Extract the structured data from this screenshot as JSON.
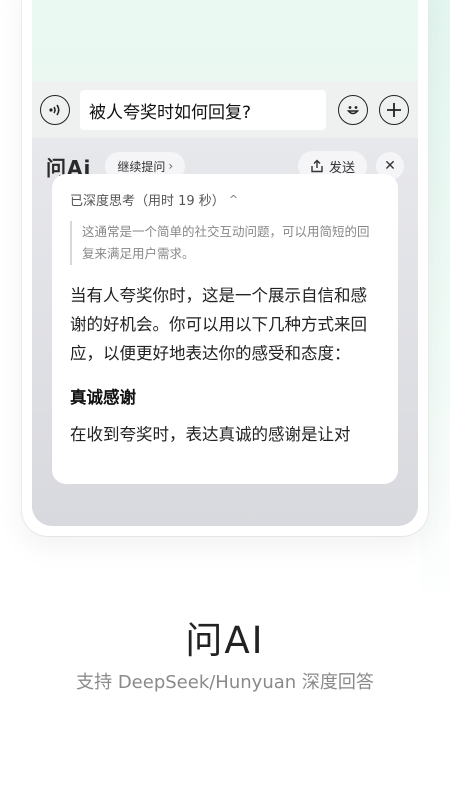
{
  "chat": {
    "input_value": "被人夸奖时如何回复?"
  },
  "ai_panel": {
    "logo": "问Ai",
    "follow_up_label": "继续提问",
    "send_label": "发送",
    "close_symbol": "✕",
    "thinking_status": "已深度思考（用时 19 秒）",
    "thinking_note": "这通常是一个简单的社交互动问题，可以用简短的回复来满足用户需求。",
    "answer_intro": "当有人夸奖你时，这是一个展示自信和感谢的好机会。你可以用以下几种方式来回应，以便更好地表达你的感受和态度：",
    "section_title": "真诚感谢",
    "section_text": "在收到夸奖时，表达真诚的感谢是让对"
  },
  "caption": {
    "title": "问AI",
    "subtitle": "支持 DeepSeek/Hunyuan 深度回答"
  },
  "colors": {
    "accent_green_light": "#eafaf3",
    "panel_gray": "#dfe0e5"
  }
}
